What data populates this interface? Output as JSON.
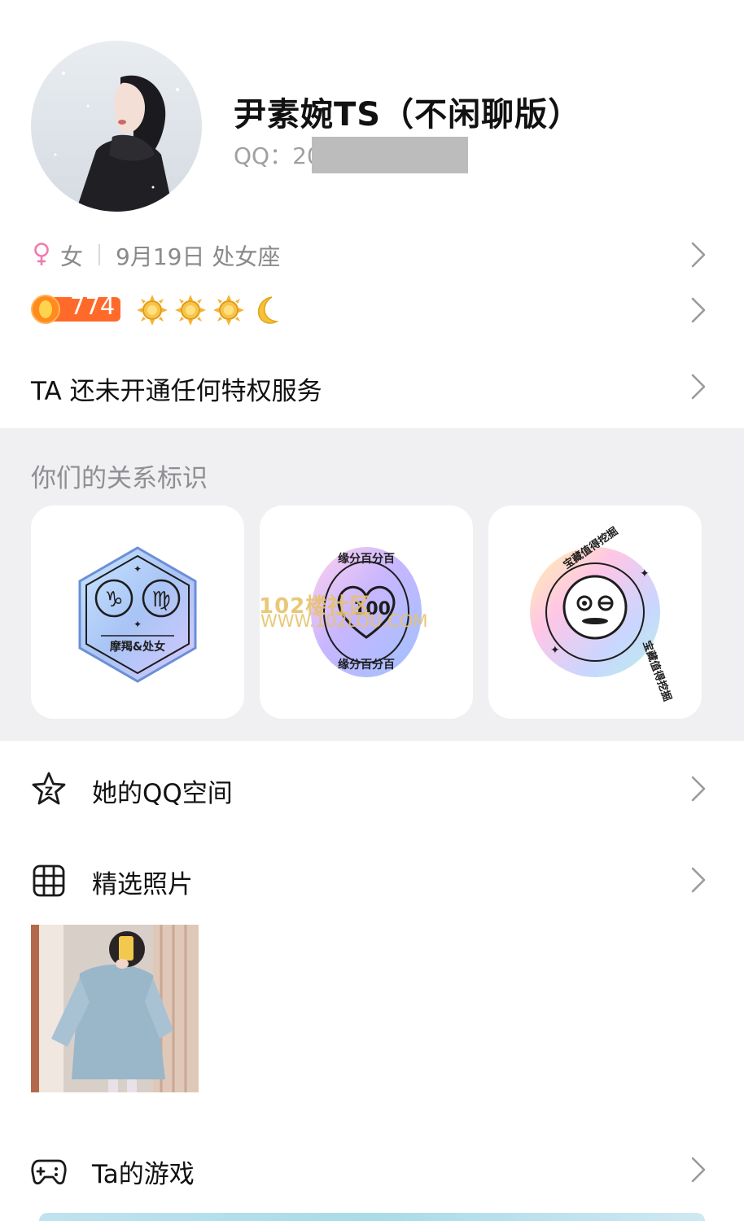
{
  "profile": {
    "name": "尹素婉TS（不闲聊版）",
    "qq_label": "QQ：20"
  },
  "info": {
    "gender": "女",
    "birthday": "9月19日 处女座"
  },
  "level": {
    "value": "774",
    "icons": [
      "sun-icon",
      "sun-icon",
      "sun-icon",
      "moon-icon"
    ]
  },
  "privilege": {
    "text": "TA 还未开通任何特权服务"
  },
  "relationship": {
    "title": "你们的关系标识",
    "badges": [
      {
        "icon": "zodiac-capricorn-virgo-badge",
        "label": "摩羯&处女"
      },
      {
        "icon": "heart-100-badge",
        "label": "缘分百分百",
        "center": "100"
      },
      {
        "icon": "treasure-face-badge",
        "label": "宝藏值得挖掘"
      }
    ]
  },
  "watermark": {
    "line1": "102楼社区",
    "line2": "WWW.102LOU.COM"
  },
  "list": {
    "qzone": "她的QQ空间",
    "photos": "精选照片",
    "games": "Ta的游戏"
  },
  "colors": {
    "female": "#f27ab0",
    "level_badge": "#ff6a2b",
    "sun": "#f5b431",
    "section_bg": "#f0f0f2",
    "chevron": "#9a9a9a"
  }
}
